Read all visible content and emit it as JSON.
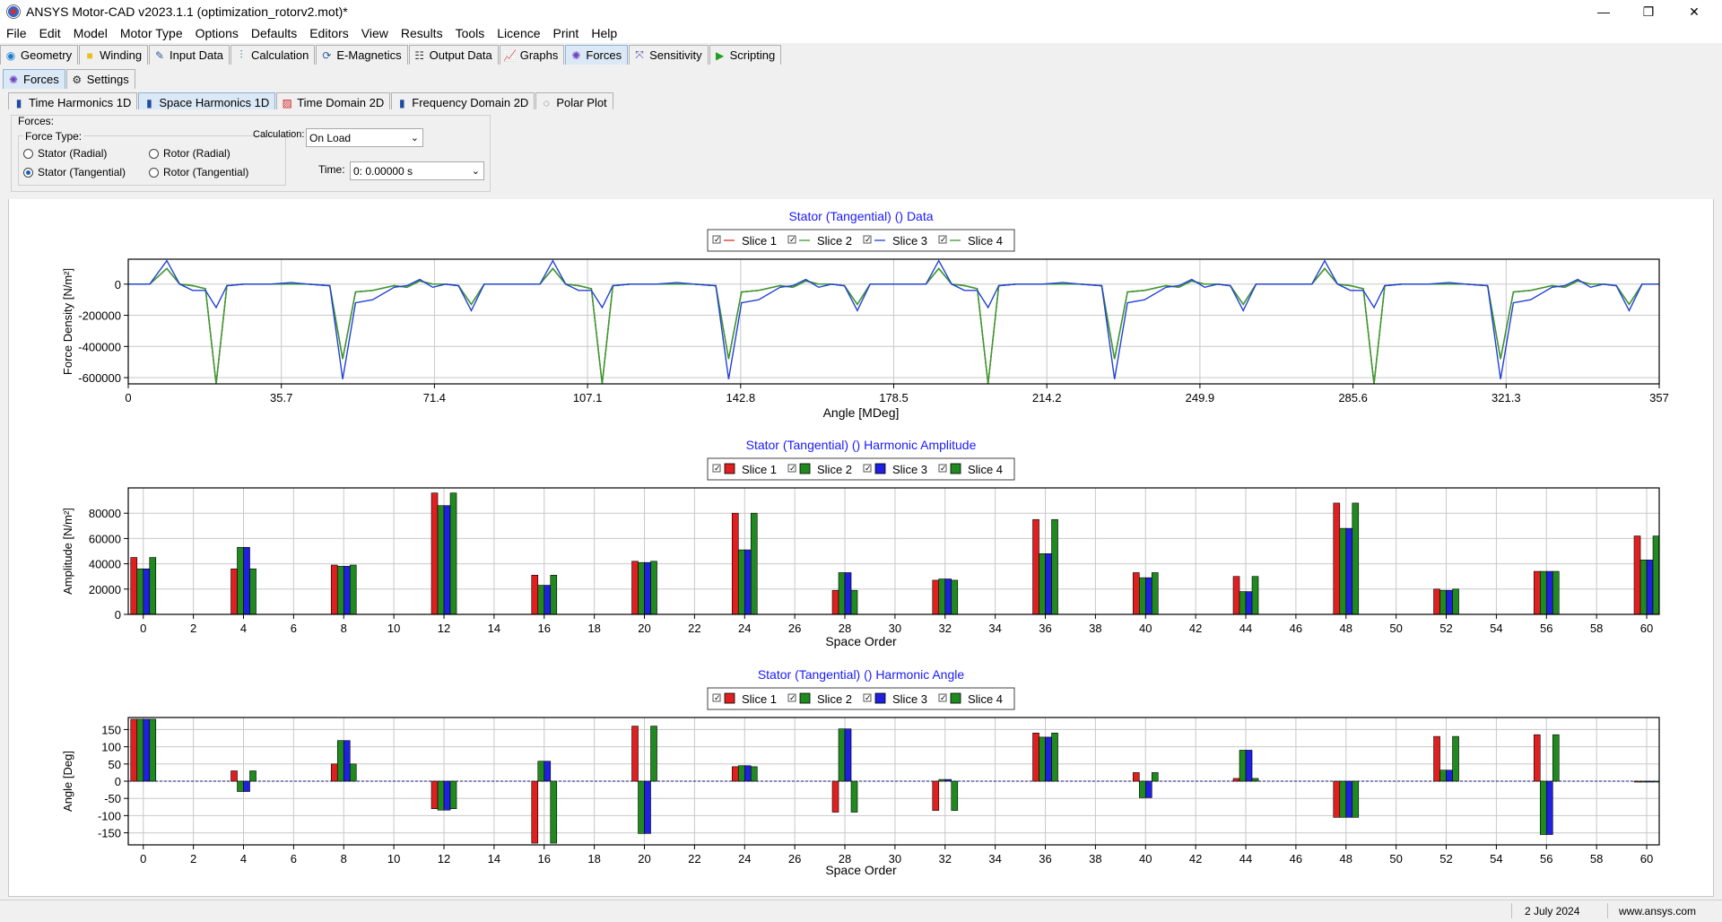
{
  "window": {
    "title": "ANSYS Motor-CAD v2023.1.1 (optimization_rotorv2.mot)*"
  },
  "menu": [
    "File",
    "Edit",
    "Model",
    "Motor Type",
    "Options",
    "Defaults",
    "Editors",
    "View",
    "Results",
    "Tools",
    "Licence",
    "Print",
    "Help"
  ],
  "main_tabs": [
    {
      "label": "Geometry",
      "icon": "geometry-icon",
      "active": false
    },
    {
      "label": "Winding",
      "icon": "winding-icon",
      "active": false
    },
    {
      "label": "Input Data",
      "icon": "input-data-icon",
      "active": false
    },
    {
      "label": "Calculation",
      "icon": "calculation-icon",
      "active": false
    },
    {
      "label": "E-Magnetics",
      "icon": "emagnetics-icon",
      "active": false
    },
    {
      "label": "Output Data",
      "icon": "output-data-icon",
      "active": false
    },
    {
      "label": "Graphs",
      "icon": "graphs-icon",
      "active": false
    },
    {
      "label": "Forces",
      "icon": "forces-icon",
      "active": true
    },
    {
      "label": "Sensitivity",
      "icon": "sensitivity-icon",
      "active": false
    },
    {
      "label": "Scripting",
      "icon": "scripting-icon",
      "active": false
    }
  ],
  "sub_tabs": [
    {
      "label": "Forces",
      "icon": "forces-icon",
      "active": true
    },
    {
      "label": "Settings",
      "icon": "gear-icon",
      "active": false
    }
  ],
  "view_tabs": [
    {
      "label": "Time Harmonics 1D",
      "icon": "bar-chart-icon",
      "active": false
    },
    {
      "label": "Space Harmonics 1D",
      "icon": "bar-chart-icon",
      "active": true
    },
    {
      "label": "Time Domain 2D",
      "icon": "hatch-icon",
      "active": false
    },
    {
      "label": "Frequency Domain 2D",
      "icon": "bar-chart-icon",
      "active": false
    },
    {
      "label": "Polar Plot",
      "icon": "polar-icon",
      "active": false
    }
  ],
  "controls": {
    "forces_label": "Forces:",
    "force_type_label": "Force Type:",
    "radios": [
      {
        "label": "Stator (Radial)",
        "checked": false
      },
      {
        "label": "Rotor (Radial)",
        "checked": false
      },
      {
        "label": "Stator (Tangential)",
        "checked": true
      },
      {
        "label": "Rotor (Tangential)",
        "checked": false
      }
    ],
    "calculation_label": "Calculation:",
    "calculation_value": "On Load",
    "time_label": "Time:",
    "time_value": "0:  0.00000 s"
  },
  "legend_labels": [
    "Slice 1",
    "Slice 2",
    "Slice 3",
    "Slice 4"
  ],
  "chart_data": [
    {
      "type": "line",
      "title": "Stator (Tangential) () Data",
      "xlabel": "Angle [MDeg]",
      "ylabel": "Force Density [N/m²]",
      "x_ticks": [
        "0",
        "35.7",
        "71.4",
        "107.1",
        "142.8",
        "178.5",
        "214.2",
        "249.9",
        "285.6",
        "321.3",
        "357"
      ],
      "y_ticks": [
        "0",
        "-200000",
        "-400000",
        "-600000"
      ],
      "xlim": [
        0,
        357
      ],
      "ylim": [
        -640000,
        160000
      ],
      "grid": true,
      "legend": "top-center",
      "series": [
        {
          "name": "Slice 1",
          "color": "#e03030",
          "pattern": "A"
        },
        {
          "name": "Slice 2",
          "color": "#3a9a30",
          "pattern": "A"
        },
        {
          "name": "Slice 3",
          "color": "#2040d8",
          "pattern": "B"
        },
        {
          "name": "Slice 4",
          "color": "#3a9a30",
          "pattern": "A"
        }
      ],
      "pattern_A": [
        [
          0,
          0
        ],
        [
          5,
          0
        ],
        [
          9,
          100000
        ],
        [
          12,
          0
        ],
        [
          15,
          -10000
        ],
        [
          18,
          -30000
        ],
        [
          20.5,
          -640000
        ],
        [
          23,
          -10000
        ],
        [
          27,
          0
        ],
        [
          33,
          0
        ],
        [
          38,
          0
        ],
        [
          42,
          0
        ],
        [
          47,
          -10000
        ],
        [
          50,
          -480000
        ],
        [
          53,
          -50000
        ],
        [
          57,
          -40000
        ],
        [
          62,
          -10000
        ],
        [
          65,
          -20000
        ],
        [
          68,
          20000
        ],
        [
          71,
          0
        ],
        [
          74,
          0
        ],
        [
          77,
          -10000
        ],
        [
          80,
          -130000
        ],
        [
          83,
          0
        ],
        [
          96,
          0
        ],
        [
          99,
          100000
        ],
        [
          102,
          0
        ],
        [
          105,
          -10000
        ],
        [
          108,
          -30000
        ],
        [
          110.5,
          -640000
        ],
        [
          113,
          -10000
        ],
        [
          117,
          0
        ],
        [
          123,
          0
        ],
        [
          128,
          0
        ],
        [
          132,
          0
        ],
        [
          137,
          -10000
        ],
        [
          140,
          -480000
        ],
        [
          143,
          -50000
        ],
        [
          147,
          -40000
        ],
        [
          152,
          -10000
        ],
        [
          155,
          -20000
        ],
        [
          158,
          20000
        ],
        [
          161,
          0
        ],
        [
          164,
          0
        ],
        [
          167,
          -10000
        ],
        [
          170,
          -130000
        ],
        [
          173,
          0
        ],
        [
          186,
          0
        ],
        [
          189,
          100000
        ],
        [
          192,
          0
        ],
        [
          195,
          -10000
        ],
        [
          198,
          -30000
        ],
        [
          200.5,
          -640000
        ],
        [
          203,
          -10000
        ],
        [
          207,
          0
        ],
        [
          213,
          0
        ],
        [
          218,
          0
        ],
        [
          222,
          0
        ],
        [
          227,
          -10000
        ],
        [
          230,
          -480000
        ],
        [
          233,
          -50000
        ],
        [
          237,
          -40000
        ],
        [
          242,
          -10000
        ],
        [
          245,
          -20000
        ],
        [
          248,
          20000
        ],
        [
          251,
          0
        ],
        [
          254,
          0
        ],
        [
          257,
          -10000
        ],
        [
          260,
          -130000
        ],
        [
          263,
          0
        ],
        [
          276,
          0
        ],
        [
          279,
          100000
        ],
        [
          282,
          0
        ],
        [
          285,
          -10000
        ],
        [
          288,
          -30000
        ],
        [
          290.5,
          -640000
        ],
        [
          293,
          -10000
        ],
        [
          297,
          0
        ],
        [
          303,
          0
        ],
        [
          308,
          0
        ],
        [
          312,
          0
        ],
        [
          317,
          -10000
        ],
        [
          320,
          -480000
        ],
        [
          323,
          -50000
        ],
        [
          327,
          -40000
        ],
        [
          332,
          -10000
        ],
        [
          335,
          -20000
        ],
        [
          338,
          20000
        ],
        [
          341,
          0
        ],
        [
          344,
          0
        ],
        [
          347,
          -10000
        ],
        [
          350,
          -130000
        ],
        [
          353,
          0
        ],
        [
          357,
          0
        ]
      ],
      "pattern_B": [
        [
          0,
          0
        ],
        [
          5,
          0
        ],
        [
          9,
          150000
        ],
        [
          12,
          0
        ],
        [
          15,
          -40000
        ],
        [
          18,
          -40000
        ],
        [
          20.5,
          -150000
        ],
        [
          23,
          -10000
        ],
        [
          27,
          0
        ],
        [
          33,
          0
        ],
        [
          38,
          10000
        ],
        [
          42,
          0
        ],
        [
          47,
          -10000
        ],
        [
          50,
          -610000
        ],
        [
          53,
          -120000
        ],
        [
          57,
          -100000
        ],
        [
          62,
          -20000
        ],
        [
          65,
          -10000
        ],
        [
          68,
          30000
        ],
        [
          71,
          -20000
        ],
        [
          74,
          0
        ],
        [
          77,
          -10000
        ],
        [
          80,
          -170000
        ],
        [
          83,
          0
        ],
        [
          96,
          0
        ],
        [
          99,
          150000
        ],
        [
          102,
          0
        ],
        [
          105,
          -40000
        ],
        [
          108,
          -40000
        ],
        [
          110.5,
          -150000
        ],
        [
          113,
          -10000
        ],
        [
          117,
          0
        ],
        [
          123,
          0
        ],
        [
          128,
          10000
        ],
        [
          132,
          0
        ],
        [
          137,
          -10000
        ],
        [
          140,
          -610000
        ],
        [
          143,
          -120000
        ],
        [
          147,
          -100000
        ],
        [
          152,
          -20000
        ],
        [
          155,
          -10000
        ],
        [
          158,
          30000
        ],
        [
          161,
          -20000
        ],
        [
          164,
          0
        ],
        [
          167,
          -10000
        ],
        [
          170,
          -170000
        ],
        [
          173,
          0
        ],
        [
          186,
          0
        ],
        [
          189,
          150000
        ],
        [
          192,
          0
        ],
        [
          195,
          -40000
        ],
        [
          198,
          -40000
        ],
        [
          200.5,
          -150000
        ],
        [
          203,
          -10000
        ],
        [
          207,
          0
        ],
        [
          213,
          0
        ],
        [
          218,
          10000
        ],
        [
          222,
          0
        ],
        [
          227,
          -10000
        ],
        [
          230,
          -610000
        ],
        [
          233,
          -120000
        ],
        [
          237,
          -100000
        ],
        [
          242,
          -20000
        ],
        [
          245,
          -10000
        ],
        [
          248,
          30000
        ],
        [
          251,
          -20000
        ],
        [
          254,
          0
        ],
        [
          257,
          -10000
        ],
        [
          260,
          -170000
        ],
        [
          263,
          0
        ],
        [
          276,
          0
        ],
        [
          279,
          150000
        ],
        [
          282,
          0
        ],
        [
          285,
          -40000
        ],
        [
          288,
          -40000
        ],
        [
          290.5,
          -150000
        ],
        [
          293,
          -10000
        ],
        [
          297,
          0
        ],
        [
          303,
          0
        ],
        [
          308,
          10000
        ],
        [
          312,
          0
        ],
        [
          317,
          -10000
        ],
        [
          320,
          -610000
        ],
        [
          323,
          -120000
        ],
        [
          327,
          -100000
        ],
        [
          332,
          -20000
        ],
        [
          335,
          -10000
        ],
        [
          338,
          30000
        ],
        [
          341,
          -20000
        ],
        [
          344,
          0
        ],
        [
          347,
          -10000
        ],
        [
          350,
          -170000
        ],
        [
          353,
          0
        ],
        [
          357,
          0
        ]
      ]
    },
    {
      "type": "bar",
      "title": "Stator (Tangential) () Harmonic Amplitude",
      "xlabel": "Space Order",
      "ylabel": "Amplitude [N/m²]",
      "categories": [
        0,
        4,
        8,
        12,
        16,
        20,
        24,
        28,
        32,
        36,
        40,
        44,
        48,
        52,
        56,
        60
      ],
      "x_ticks": [
        "0",
        "2",
        "4",
        "6",
        "8",
        "10",
        "12",
        "14",
        "16",
        "18",
        "20",
        "22",
        "24",
        "26",
        "28",
        "30",
        "32",
        "34",
        "36",
        "38",
        "40",
        "42",
        "44",
        "46",
        "48",
        "50",
        "52",
        "54",
        "56",
        "58",
        "60"
      ],
      "y_ticks": [
        "0",
        "20000",
        "40000",
        "60000",
        "80000"
      ],
      "xlim": [
        -0.6,
        60.5
      ],
      "ylim": [
        0,
        100000
      ],
      "grid": true,
      "legend": "top-center",
      "series": [
        {
          "name": "Slice 1",
          "color": "#e02020",
          "values": [
            45000,
            36000,
            39000,
            96000,
            31000,
            42000,
            80000,
            19000,
            27000,
            75000,
            33000,
            30000,
            88000,
            20000,
            34000,
            62000
          ]
        },
        {
          "name": "Slice 2",
          "color": "#208a20",
          "values": [
            36000,
            53000,
            38000,
            86000,
            23000,
            41000,
            51000,
            33000,
            28000,
            48000,
            29000,
            18000,
            68000,
            19000,
            34000,
            43000
          ]
        },
        {
          "name": "Slice 3",
          "color": "#2020e0",
          "values": [
            36000,
            53000,
            38000,
            86000,
            23000,
            41000,
            51000,
            33000,
            28000,
            48000,
            29000,
            18000,
            68000,
            19000,
            34000,
            43000
          ]
        },
        {
          "name": "Slice 4",
          "color": "#208a20",
          "values": [
            45000,
            36000,
            39000,
            96000,
            31000,
            42000,
            80000,
            19000,
            27000,
            75000,
            33000,
            30000,
            88000,
            20000,
            34000,
            62000
          ]
        }
      ]
    },
    {
      "type": "bar",
      "title": "Stator (Tangential) () Harmonic Angle",
      "xlabel": "Space Order",
      "ylabel": "Angle [Deg]",
      "categories": [
        0,
        4,
        8,
        12,
        16,
        20,
        24,
        28,
        32,
        36,
        40,
        44,
        48,
        52,
        56,
        60
      ],
      "x_ticks": [
        "0",
        "2",
        "4",
        "6",
        "8",
        "10",
        "12",
        "14",
        "16",
        "18",
        "20",
        "22",
        "24",
        "26",
        "28",
        "30",
        "32",
        "34",
        "36",
        "38",
        "40",
        "42",
        "44",
        "46",
        "48",
        "50",
        "52",
        "54",
        "56",
        "58",
        "60"
      ],
      "y_ticks": [
        "150",
        "100",
        "50",
        "0",
        "-50",
        "-100",
        "-150"
      ],
      "xlim": [
        -0.6,
        60.5
      ],
      "ylim": [
        -185,
        185
      ],
      "grid": true,
      "legend": "top-center",
      "series": [
        {
          "name": "Slice 1",
          "color": "#e02020",
          "values": [
            180,
            30,
            50,
            -80,
            -180,
            160,
            42,
            -90,
            -85,
            140,
            25,
            8,
            -105,
            130,
            135,
            0
          ]
        },
        {
          "name": "Slice 2",
          "color": "#208a20",
          "values": [
            180,
            -30,
            118,
            -84,
            58,
            -152,
            45,
            152,
            5,
            128,
            -48,
            90,
            -105,
            32,
            -155,
            0
          ]
        },
        {
          "name": "Slice 3",
          "color": "#2020e0",
          "values": [
            180,
            -30,
            118,
            -84,
            58,
            -152,
            45,
            152,
            5,
            128,
            -48,
            90,
            -105,
            32,
            -155,
            0
          ]
        },
        {
          "name": "Slice 4",
          "color": "#208a20",
          "values": [
            180,
            30,
            50,
            -80,
            -180,
            160,
            42,
            -90,
            -85,
            140,
            25,
            8,
            -105,
            130,
            135,
            0
          ]
        }
      ]
    }
  ],
  "status": {
    "date": "2 July 2024",
    "website": "www.ansys.com"
  }
}
